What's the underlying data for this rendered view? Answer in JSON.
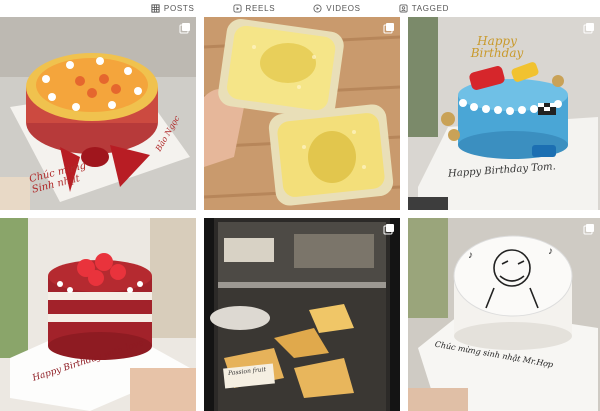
{
  "tabs": [
    {
      "label": "POSTS",
      "icon": "grid-icon"
    },
    {
      "label": "REELS",
      "icon": "reels-icon"
    },
    {
      "label": "VIDEOS",
      "icon": "video-icon"
    },
    {
      "label": "TAGGED",
      "icon": "tagged-icon"
    }
  ],
  "posts": [
    {
      "id": "p1",
      "subject": "mango cake with red ribbon",
      "multi": true,
      "note_lines": [
        "Chúc mừng",
        "Sinh nhật"
      ],
      "side_note": "Bảo Ngọc"
    },
    {
      "id": "p2",
      "subject": "durian cream boxes",
      "multi": true
    },
    {
      "id": "p3",
      "subject": "cars themed blue birthday cake",
      "multi": true,
      "topper": "Happy Birthday",
      "note": "Happy Birthday Tom."
    },
    {
      "id": "p4",
      "subject": "red velvet naked cake with strawberries",
      "multi": false,
      "note": "Happy Birthday with love"
    },
    {
      "id": "p5",
      "subject": "cake slices in display case",
      "multi": true,
      "label": "Passion fruit"
    },
    {
      "id": "p6",
      "subject": "meme face drawing cake",
      "multi": true,
      "note": "Chúc mừng sinh nhật Mr.Hợp"
    }
  ],
  "colors": {
    "tab_text": "#555555",
    "border": "#dbdbdb"
  }
}
